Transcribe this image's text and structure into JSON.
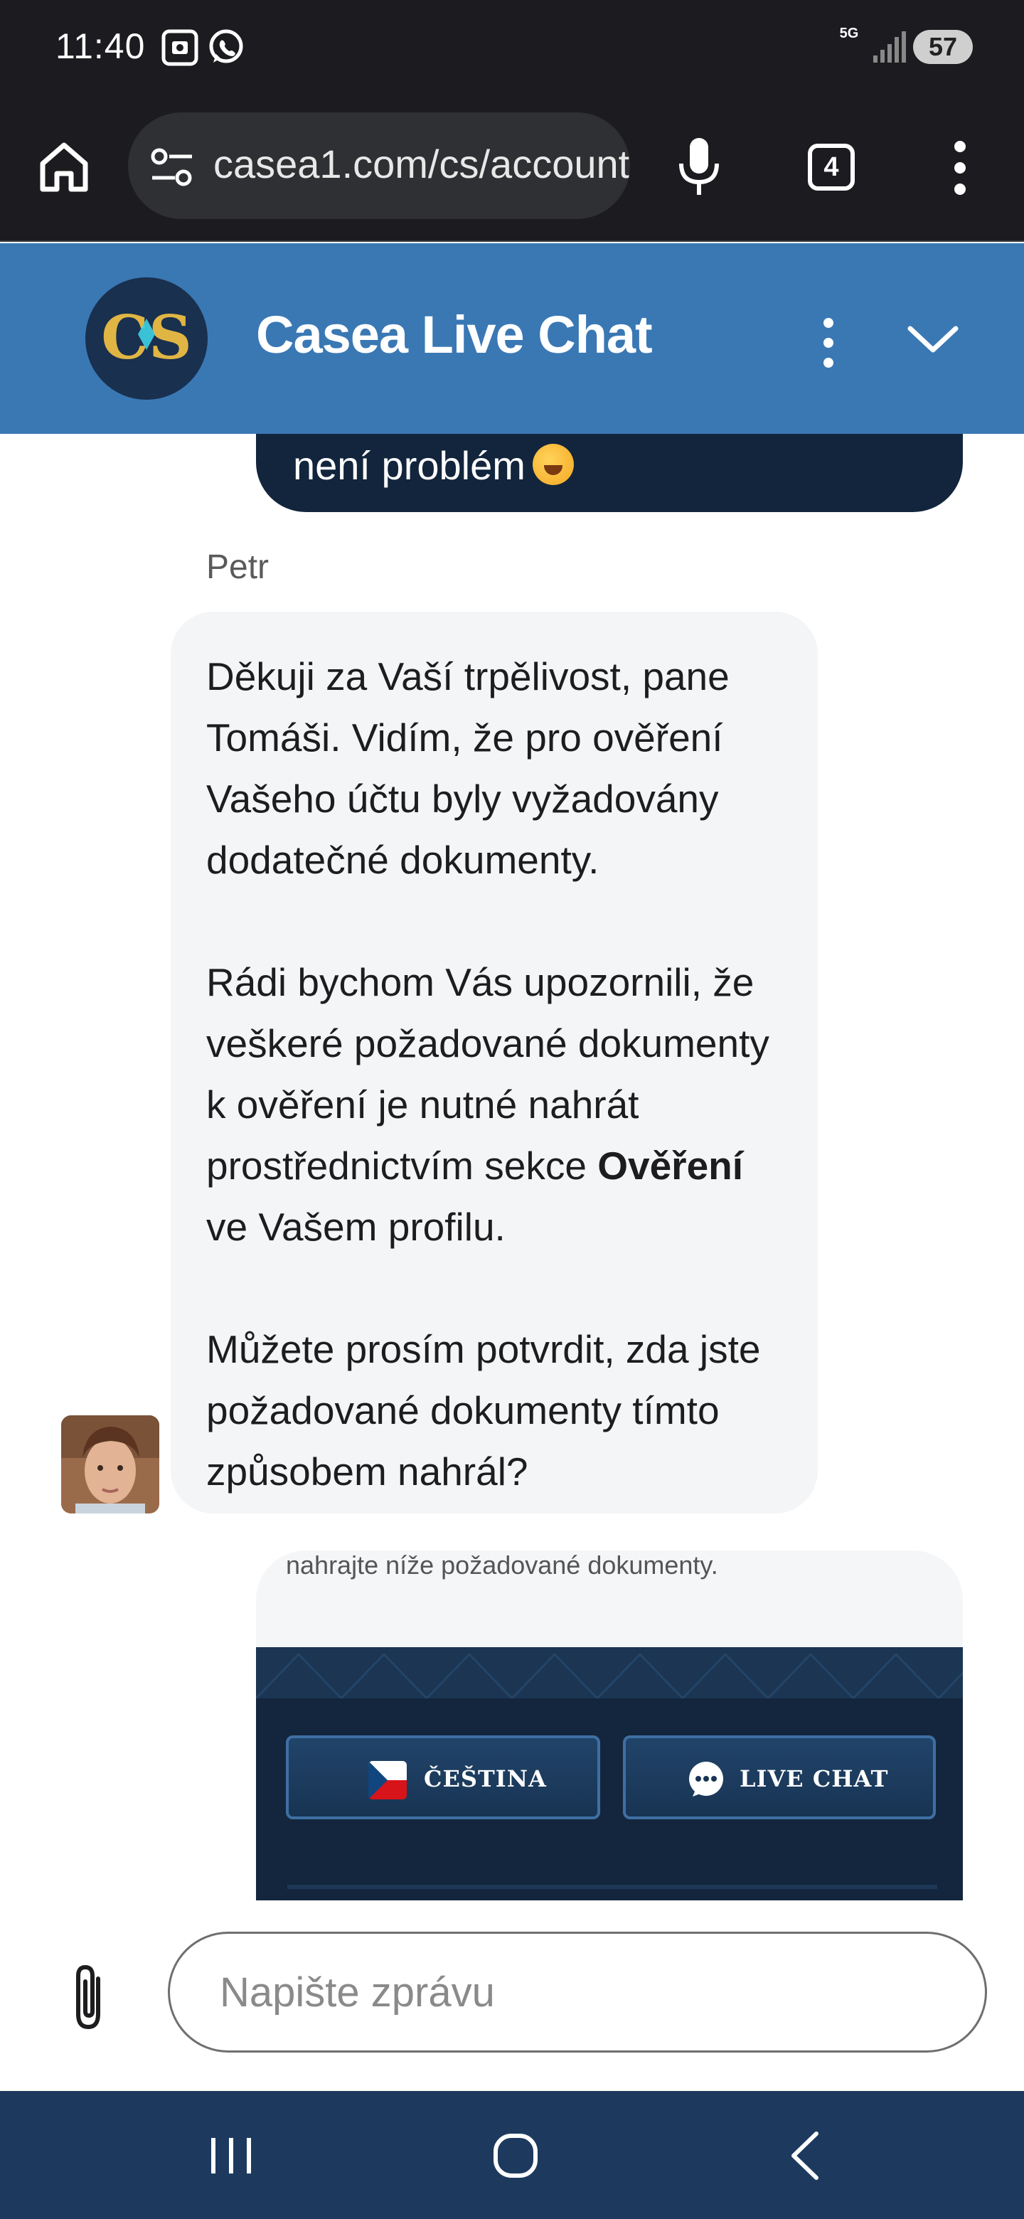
{
  "status_bar": {
    "time": "11:40",
    "network": "5G",
    "battery": "57",
    "icons": [
      "screenshot-icon",
      "whatsapp-icon",
      "signal-icon"
    ]
  },
  "browser": {
    "url": "casea1.com/cs/account",
    "tab_count": "4"
  },
  "chat_header": {
    "logo_text": "CS",
    "title": "Casea Live Chat"
  },
  "messages": {
    "previous_outgoing": "není problém",
    "incoming": {
      "sender": "Petr",
      "paragraph1": "Děkuji za Vaší trpělivost, pane Tomáši. Vidím, že pro ověření Vašeho účtu byly vyžadovány dodatečné dokumenty.",
      "paragraph2_before": "Rádi bychom Vás upozornili, že veškeré požadované dokumenty k ověření je nutné nahrát prostřednictvím sekce ",
      "paragraph2_bold": "Ověření",
      "paragraph2_after": " ve Vašem profilu.",
      "paragraph3": "Můžete prosím potvrdit, zda jste požadované dokumenty tímto způsobem nahrál?"
    },
    "outgoing_card": {
      "caption": "nahrajte níže požadované dokumenty.",
      "language_button": "ČEŠTINA",
      "livechat_button": "LIVE CHAT"
    }
  },
  "composer": {
    "placeholder": "Napište zprávu"
  },
  "colors": {
    "header_blue": "#3a78b4",
    "bubble_dark": "#12253c",
    "bubble_light": "#f4f5f7",
    "nav_bar": "#1d3a5e"
  }
}
